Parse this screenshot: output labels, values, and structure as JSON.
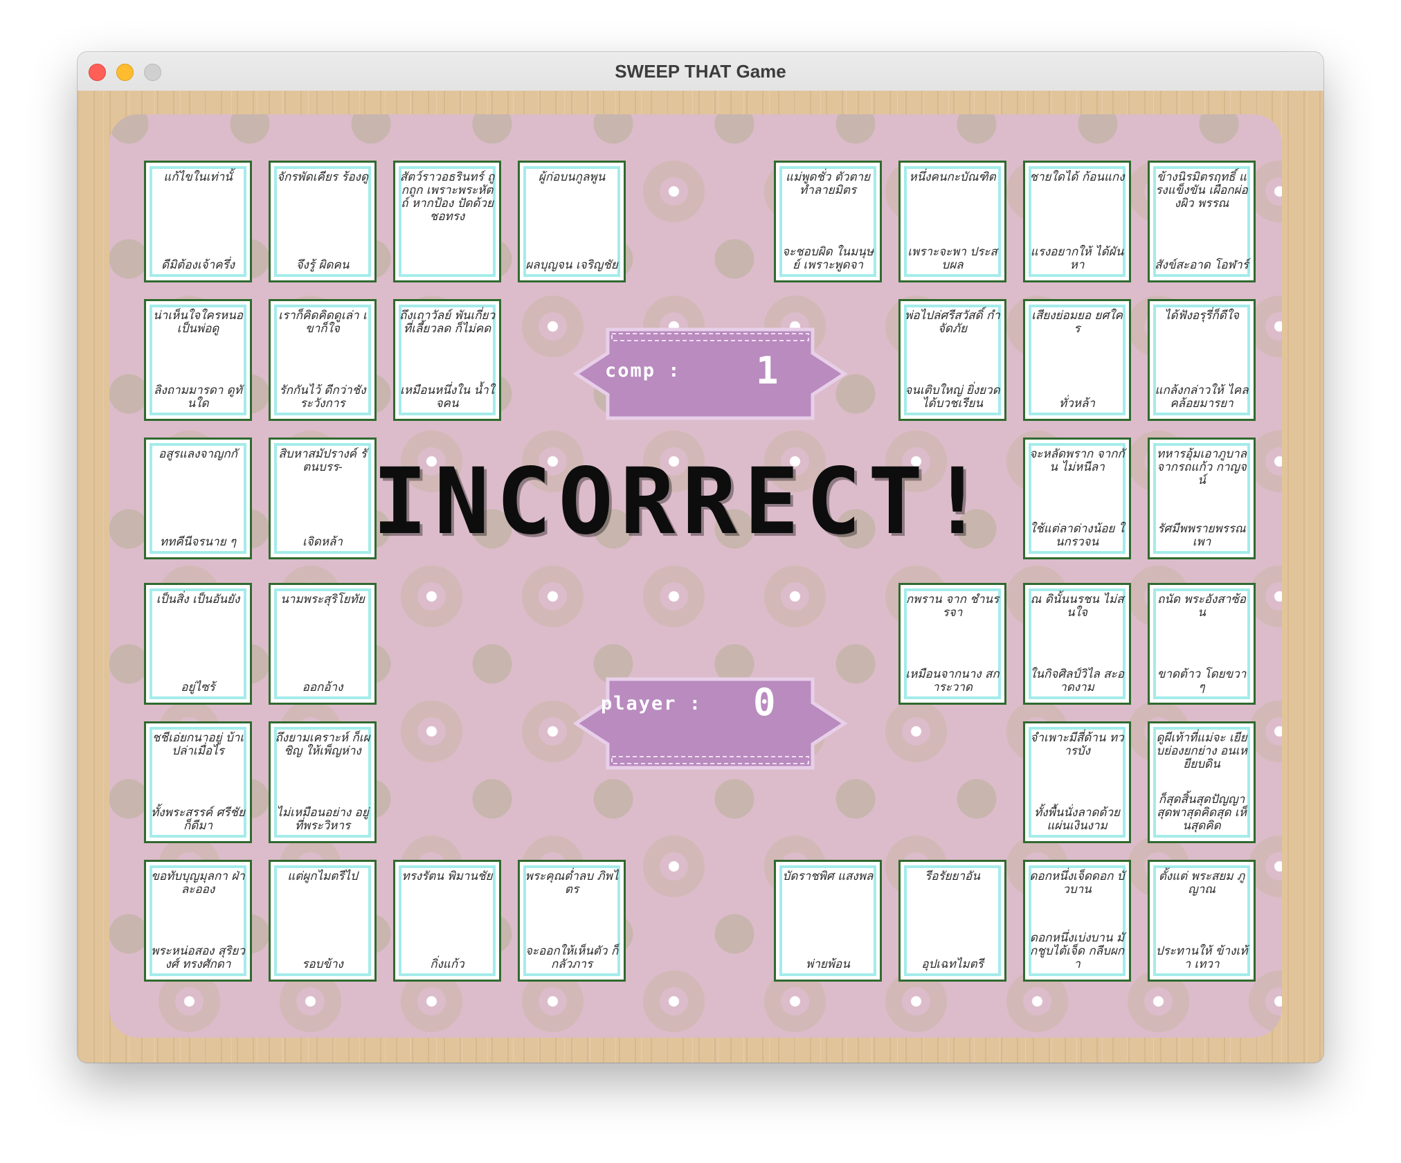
{
  "window": {
    "title": "SWEEP THAT Game"
  },
  "scores": {
    "comp": {
      "label": "comp :",
      "value": "1"
    },
    "player": {
      "label": "player :",
      "value": "0"
    }
  },
  "message": "INCORRECT!",
  "colors": {
    "board": "#dcbcca",
    "frame": "#e2c49b",
    "card_border": "#2f6a2f",
    "card_inner": "#a4ecea",
    "badge": "#b98bbf"
  },
  "cards": [
    {
      "line1": "แก้ไขในเท่านั้",
      "line2": "ดีมิต้องเจ้าครึ่ง"
    },
    {
      "line1": "จักรพัดเคียร ร้องดู",
      "line2": "จึงรู้ ผิดคน"
    },
    {
      "line1": "สัตว์ราวอธรินทร์ ถูกถูก เพราะพระหัตถ์ หากป้อง ปัดด้วย ชอทรง",
      "line2": ""
    },
    {
      "line1": "ผู้ก่อบนกูลพูน",
      "line2": "ผลบุญจน เจริญชัย"
    },
    {
      "line1": "แม่พูดชั่ว ตัวตาย ทำลายมิตร",
      "line2": "จะชอบผิด ในมนุษย์ เพราะพูดจา"
    },
    {
      "line1": "หนึ่งคนกะบัณฑิต",
      "line2": "เพราะจะพา ประสบผล"
    },
    {
      "line1": "ชายใดได้ ก้อนแกง",
      "line2": "แรงอยากให้ ได้ผันหา"
    },
    {
      "line1": "ข้างนิรมิตรฤทธิ์ แรงแข็งขัน เผือกผ่องผิว พรรณ",
      "line2": "สังข์สะอาด โอฬาร์"
    },
    {
      "line1": "น่าเห็นใจใครหนอ เป็นพ่อดู",
      "line2": "ลิงถามมารดา ดูทันใด"
    },
    {
      "line1": "เราก็คิดคิดดูเล่า เขาก็ใจ",
      "line2": "รักกันไว้ ดีกว่าชัง ระวังการ"
    },
    {
      "line1": "ถึงเถาวัลย์ พันเกี่ยว ที่เลี้ยวลด ก็ไม่คด",
      "line2": "เหมือนหนึ่งใน น้ำใจคน"
    },
    {
      "line1": "พ่อไปล่ศรีสวัสดิ์ กำจัดภัย",
      "line2": "จนเติบใหญ่ ยิ่งยวด ได้บวชเรียน"
    },
    {
      "line1": "เสียงย่อมยอ ยศใคร",
      "line2": "ทั่วหล้า"
    },
    {
      "line1": "ได้ฟังอรุรี่ก็ดีใจ",
      "line2": "แกล้งกล่าวให้ ไคลคล้อยมารยา"
    },
    {
      "line1": "จะหลัดพราก จากกัน ไม่หนีลา",
      "line2": "ใช้แต่ลาด่างน้อย ในกรวจน"
    },
    {
      "line1": "ทหารอุ้มเอาภูบาล จากรถแก้ว กาญจน์",
      "line2": "รัศมีพพรายพรรณ เพา"
    },
    {
      "line1": "อสูรแลงจาญกกั",
      "line2": "ททคีนีจรนาย ๆ"
    },
    {
      "line1": "สิบหาสมัปรางค์ รัตนบรร-",
      "line2": "เจิดหล้า"
    },
    {
      "line1": "กพราน จาก ชำนรรจา",
      "line2": "เหมือนจากนาง สการะวาด"
    },
    {
      "line1": "ณ ดินั้นนรชน ไม่สนใจ",
      "line2": "ในกิจศิลป์วิไล สะอาดงาม"
    },
    {
      "line1": "ถนัด พระอังสาซ้อน",
      "line2": "ขาดต้าว โดยขวา ๆ"
    },
    {
      "line1": "เป็นสิ่ง เป็นอันยัง",
      "line2": "อยู่ไซร้"
    },
    {
      "line1": "นามพระสุริโยทัย",
      "line2": "ออกอ้าง"
    },
    {
      "line1": "ชชีเอ่ยกนาอยู่ บ้าเปล่าเมื่อไร",
      "line2": "ทั้งพระสรรค์ ศรีชัย ก็ดีมา"
    },
    {
      "line1": "ถึงยามเคราะห์ ก็เผชิญ ให้เพ็ญห่าง",
      "line2": "ไม่เหมือนอย่าง อยู่ที่พระวิหาร"
    },
    {
      "line1": "จำเพาะมีสี่ด้าน ทวารบัง",
      "line2": "ทั้งพื้นนั่งลาดด้วย แผ่นเงินงาม"
    },
    {
      "line1": "ดูผีเท้าที่แม่จะ เยียบย่องยกย่าง อนเหยียบดิน",
      "line2": "ก็สุดสิ้นสุดปัญญา สุดพาสุดคิดสุด เห็นสุดคิด"
    },
    {
      "line1": "ขอทับบุญมุลกา ฝ่าละออง",
      "line2": "พระหน่อสอง สุริยวงศ์ ทรงศักดา"
    },
    {
      "line1": "แต่ผูกไมตรีไป",
      "line2": "รอบข้าง"
    },
    {
      "line1": "ทรงรัตน พิมานชัย",
      "line2": "กิ่งแก้ว"
    },
    {
      "line1": "พระคุณต่ำลบ ภิพไตร",
      "line2": "จะออกให้เห็นตัว ก็กลัวภาร"
    },
    {
      "line1": "บัดราชพิศ แสงพล",
      "line2": "พ่ายพ้อน"
    },
    {
      "line1": "รีอรัยยาอัน",
      "line2": "อุปเฉทไมตรี"
    },
    {
      "line1": "ดอกหนึ่งเจ็ดดอก บัวบาน",
      "line2": "ดอกหนึ่งเบ่งบาน มักชูบไต้เจ็ด กลีบผกา"
    },
    {
      "line1": "ตั้งแต่ พระสยม ภูญาณ",
      "line2": "ประทานให้ ข้างเท้า เทวา"
    }
  ]
}
